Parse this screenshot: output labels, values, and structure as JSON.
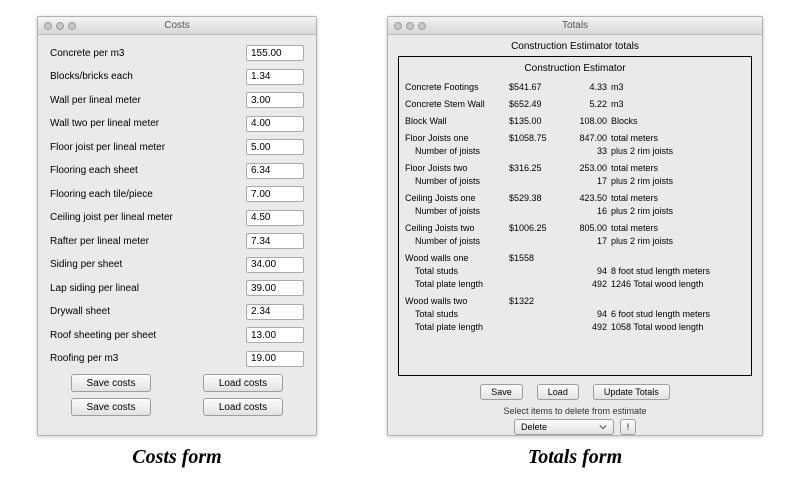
{
  "captions": {
    "left": "Costs form",
    "right": "Totals form"
  },
  "costs": {
    "title": "Costs",
    "rows": [
      {
        "label": "Concrete per  m3",
        "value": "155.00"
      },
      {
        "label": "Blocks/bricks each",
        "value": "1.34"
      },
      {
        "label": "Wall per lineal meter",
        "value": "3.00"
      },
      {
        "label": "Wall two per lineal meter",
        "value": "4.00"
      },
      {
        "label": "Floor joist per lineal meter",
        "value": "5.00"
      },
      {
        "label": "Flooring each sheet",
        "value": "6.34"
      },
      {
        "label": "Flooring each tile/piece",
        "value": "7.00"
      },
      {
        "label": "Ceiling joist per lineal meter",
        "value": "4.50"
      },
      {
        "label": "Rafter per lineal meter",
        "value": "7.34"
      },
      {
        "label": "Siding per  sheet",
        "value": "34.00"
      },
      {
        "label": "Lap siding per lineal",
        "value": "39.00"
      },
      {
        "label": "Drywall  sheet",
        "value": "2.34"
      },
      {
        "label": "Roof sheeting per sheet",
        "value": "13.00"
      },
      {
        "label": "Roofing per  m3",
        "value": "19.00"
      }
    ],
    "buttons": {
      "save": "Save costs",
      "load": "Load costs"
    }
  },
  "totals": {
    "title": "Totals",
    "header": "Construction Estimator totals",
    "reportTitle": "Construction Estimator",
    "simple": [
      {
        "name": "Concrete  Footings",
        "cost": "$541.67",
        "qty": "4.33",
        "unit": "m3"
      },
      {
        "name": "Concrete  Stem Wall",
        "cost": "$652.49",
        "qty": "5.22",
        "unit": "m3"
      },
      {
        "name": "Block Wall",
        "cost": "$135.00",
        "qty": "108.00",
        "unit": "Blocks"
      }
    ],
    "joists": [
      {
        "name": "Floor Joists  one",
        "cost": "$1058.75",
        "qty": "847.00",
        "unit": "total meters",
        "countLabel": "Number of joists",
        "count": "33",
        "extra": "plus 2 rim joists"
      },
      {
        "name": "Floor Joists  two",
        "cost": "$316.25",
        "qty": "253.00",
        "unit": "total  meters",
        "countLabel": "Number of joists",
        "count": "17",
        "extra": "plus 2 rim joists"
      },
      {
        "name": "Ceiling Joists one",
        "cost": "$529.38",
        "qty": "423.50",
        "unit": "total  meters",
        "countLabel": "Number of joists",
        "count": "16",
        "extra": "plus 2 rim joists"
      },
      {
        "name": "Ceiling Joists two",
        "cost": "$1006.25",
        "qty": "805.00",
        "unit": "total  meters",
        "countLabel": "Number of joists",
        "count": "17",
        "extra": "plus 2 rim joists"
      }
    ],
    "walls": [
      {
        "name": "Wood walls one",
        "cost": "$1558",
        "studsLabel": "Total studs",
        "studs": "94",
        "studLen": "8",
        "studUnit": "foot stud length meters",
        "plateLabel": "Total plate length",
        "plate": "492",
        "woodLen": "1246",
        "woodLabel": "Total wood length"
      },
      {
        "name": "Wood walls two",
        "cost": "$1322",
        "studsLabel": "Total studs",
        "studs": "94",
        "studLen": "6",
        "studUnit": "foot stud length meters",
        "plateLabel": "Total plate length",
        "plate": "492",
        "woodLen": "1058",
        "woodLabel": "Total wood length"
      }
    ],
    "buttons": {
      "save": "Save",
      "load": "Load",
      "update": "Update Totals"
    },
    "deleteLabel": "Select items to delete from estimate",
    "deleteSelect": "Delete",
    "doit": "!"
  }
}
